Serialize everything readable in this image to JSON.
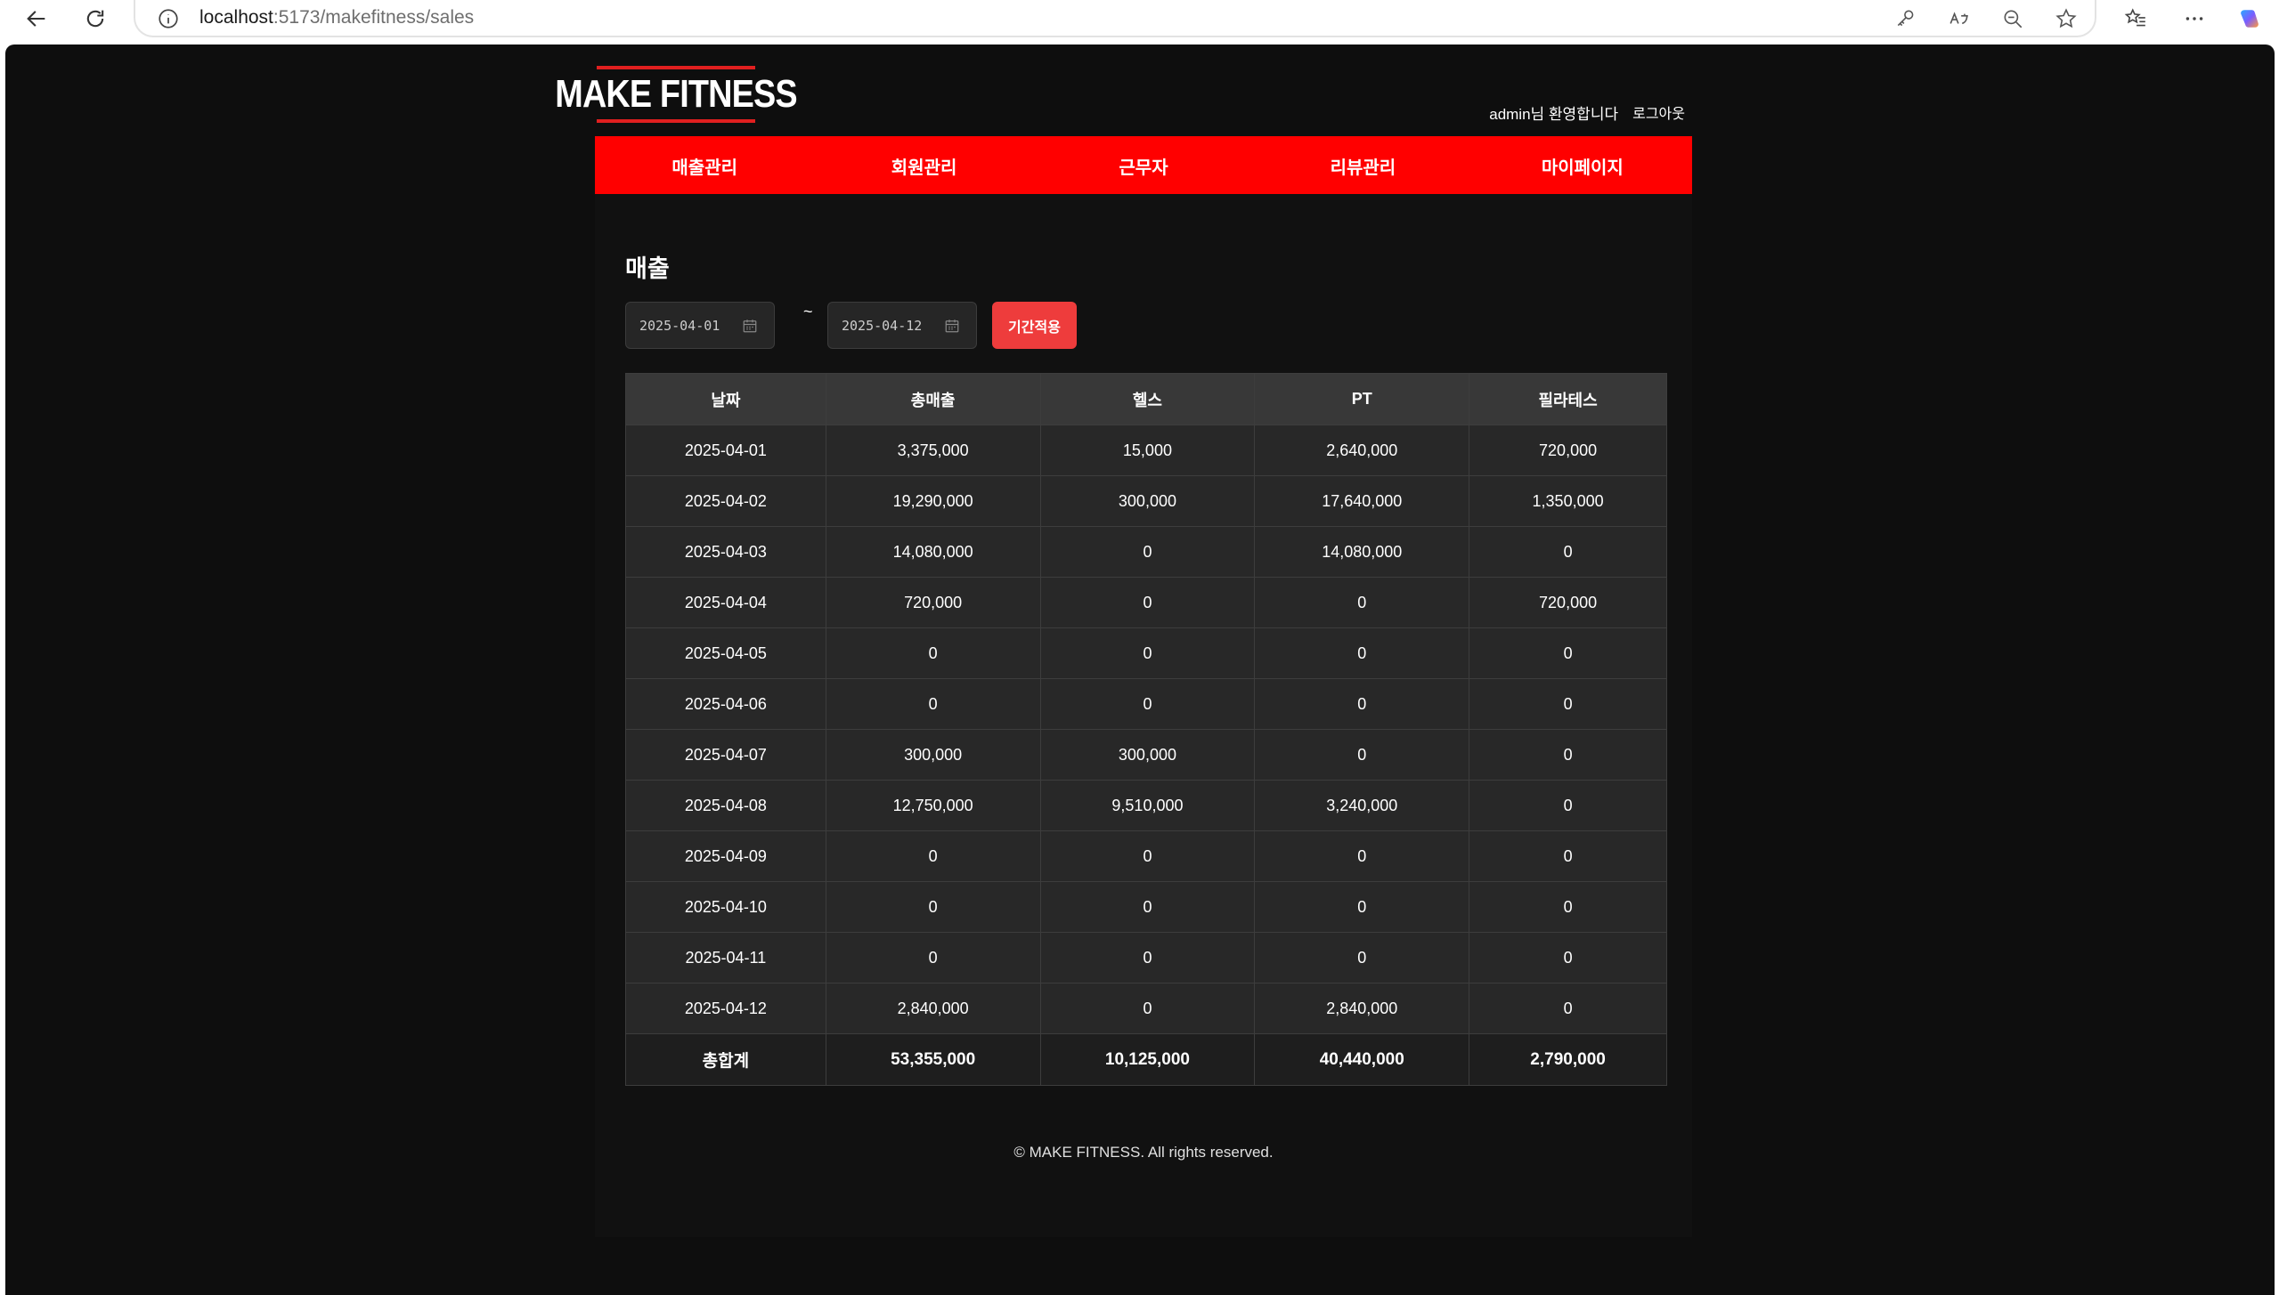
{
  "browser": {
    "url_host": "localhost",
    "url_path": ":5173/makefitness/sales"
  },
  "header": {
    "logo_text": "MAKE FITNESS",
    "welcome": "admin님 환영합니다",
    "logout": "로그아웃"
  },
  "menu": {
    "items": [
      {
        "label": "매출관리"
      },
      {
        "label": "회원관리"
      },
      {
        "label": "근무자"
      },
      {
        "label": "리뷰관리"
      },
      {
        "label": "마이페이지"
      }
    ]
  },
  "sales": {
    "title": "매출",
    "start_date": "2025-04-01",
    "end_date": "2025-04-12",
    "separator": "~",
    "apply_label": "기간적용",
    "columns": [
      "날짜",
      "총매출",
      "헬스",
      "PT",
      "필라테스"
    ],
    "rows": [
      [
        "2025-04-01",
        "3,375,000",
        "15,000",
        "2,640,000",
        "720,000"
      ],
      [
        "2025-04-02",
        "19,290,000",
        "300,000",
        "17,640,000",
        "1,350,000"
      ],
      [
        "2025-04-03",
        "14,080,000",
        "0",
        "14,080,000",
        "0"
      ],
      [
        "2025-04-04",
        "720,000",
        "0",
        "0",
        "720,000"
      ],
      [
        "2025-04-05",
        "0",
        "0",
        "0",
        "0"
      ],
      [
        "2025-04-06",
        "0",
        "0",
        "0",
        "0"
      ],
      [
        "2025-04-07",
        "300,000",
        "300,000",
        "0",
        "0"
      ],
      [
        "2025-04-08",
        "12,750,000",
        "9,510,000",
        "3,240,000",
        "0"
      ],
      [
        "2025-04-09",
        "0",
        "0",
        "0",
        "0"
      ],
      [
        "2025-04-10",
        "0",
        "0",
        "0",
        "0"
      ],
      [
        "2025-04-11",
        "0",
        "0",
        "0",
        "0"
      ],
      [
        "2025-04-12",
        "2,840,000",
        "0",
        "2,840,000",
        "0"
      ]
    ],
    "total": [
      "총합계",
      "53,355,000",
      "10,125,000",
      "40,440,000",
      "2,790,000"
    ]
  },
  "footer": {
    "text": "© MAKE FITNESS. All rights reserved."
  },
  "colors": {
    "accent": "#ff0000",
    "apply_button": "#ee3c3c",
    "background": "#0e0e0e"
  }
}
